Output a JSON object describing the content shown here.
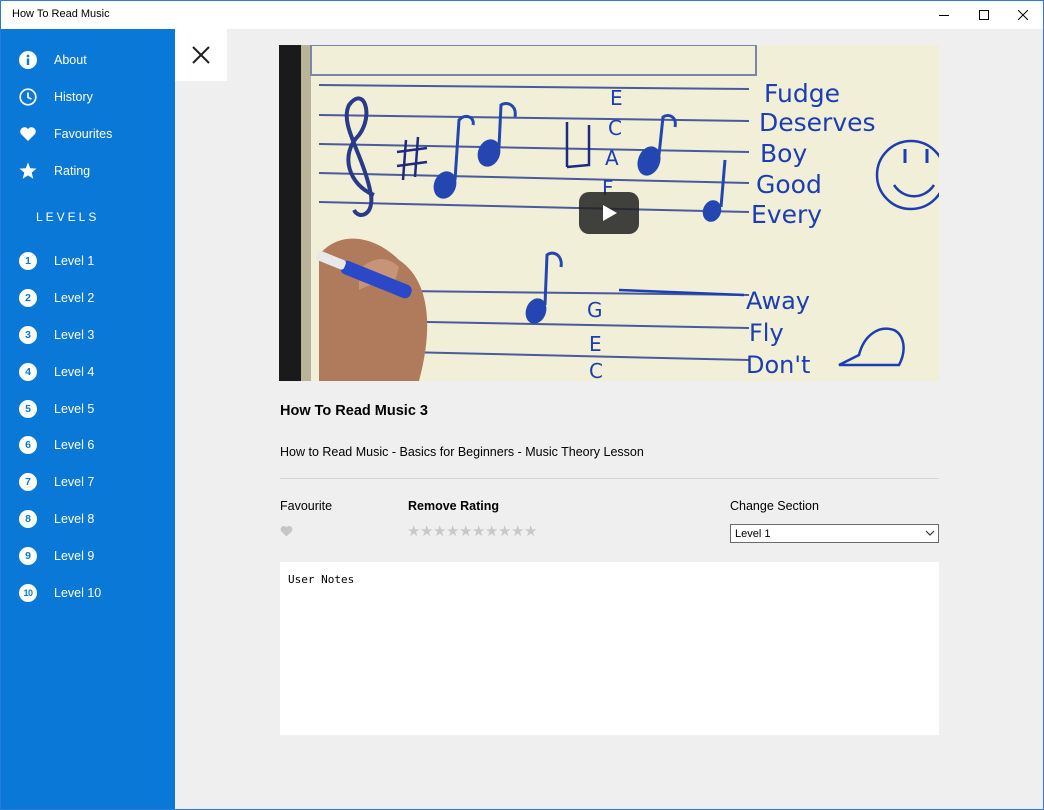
{
  "window": {
    "title": "How To Read Music"
  },
  "sidebar": {
    "menu": [
      {
        "label": "About",
        "icon": "info-icon"
      },
      {
        "label": "History",
        "icon": "clock-icon"
      },
      {
        "label": "Favourites",
        "icon": "heart-icon"
      },
      {
        "label": "Rating",
        "icon": "star-icon"
      }
    ],
    "levels_header": "LEVELS",
    "levels": [
      {
        "number": "1",
        "label": "Level 1"
      },
      {
        "number": "2",
        "label": "Level 2"
      },
      {
        "number": "3",
        "label": "Level 3"
      },
      {
        "number": "4",
        "label": "Level 4"
      },
      {
        "number": "5",
        "label": "Level 5"
      },
      {
        "number": "6",
        "label": "Level 6"
      },
      {
        "number": "7",
        "label": "Level 7"
      },
      {
        "number": "8",
        "label": "Level 8"
      },
      {
        "number": "9",
        "label": "Level 9"
      },
      {
        "number": "10",
        "label": "Level 10"
      }
    ]
  },
  "video": {
    "title": "How To Read Music 3",
    "description": "How to Read Music - Basics for Beginners - Music Theory Lesson",
    "thumbnail_text": {
      "top_notes": [
        "E",
        "C",
        "A",
        "F"
      ],
      "top_words": [
        "Fudge",
        "Deserves",
        "Boy",
        "Good",
        "Every"
      ],
      "bottom_notes": [
        "G",
        "E",
        "C"
      ],
      "bottom_words": [
        "Away",
        "Fly",
        "Don't"
      ]
    }
  },
  "details": {
    "favourite_label": "Favourite",
    "favourite_icon": "heart-icon",
    "rating_label": "Remove Rating",
    "rating_value": 0,
    "rating_max": 10,
    "section_label": "Change Section",
    "section_value": "Level 1"
  },
  "notes": {
    "placeholder": "User Notes"
  },
  "colors": {
    "accent": "#0a78d7",
    "background": "#efefef",
    "star_empty": "#c8c8c8"
  }
}
